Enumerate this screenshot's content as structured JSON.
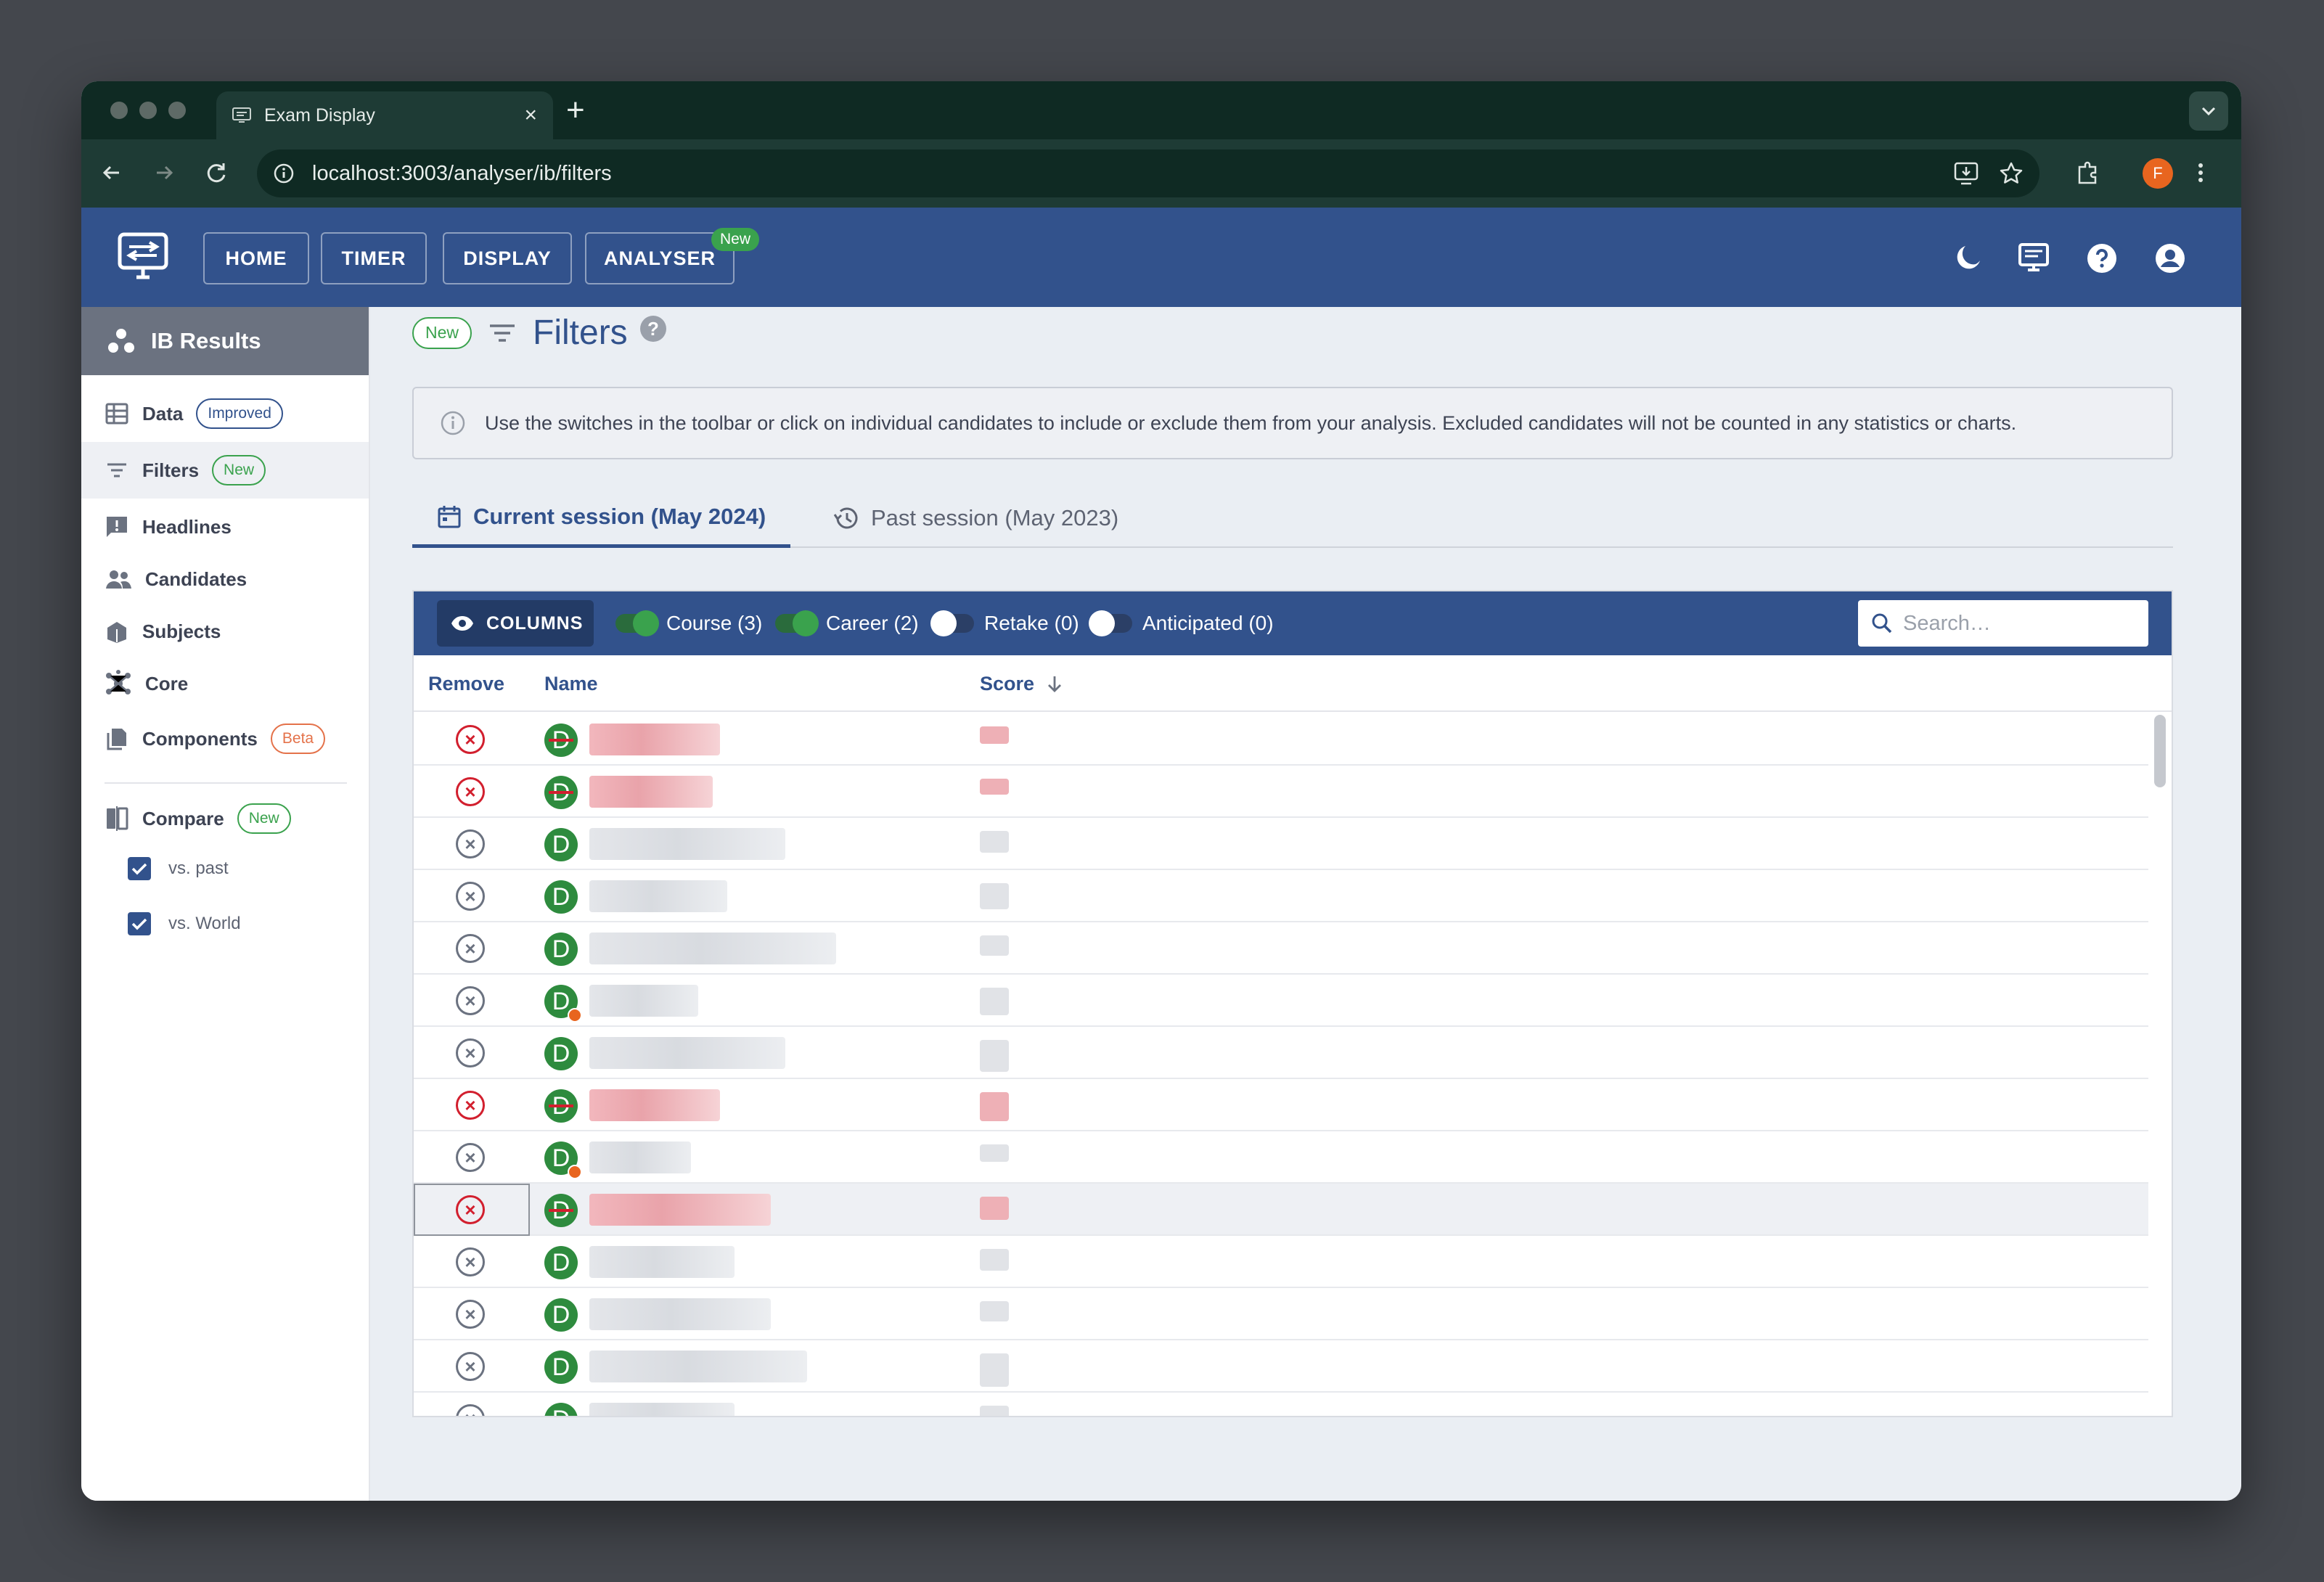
{
  "browser": {
    "tab_title": "Exam Display",
    "url": "localhost:3003/analyser/ib/filters",
    "profile_initial": "F"
  },
  "nav": {
    "home": "HOME",
    "timer": "TIMER",
    "display": "DISPLAY",
    "analyser": "ANALYSER",
    "analyser_badge": "New"
  },
  "sidebar": {
    "header": "IB Results",
    "items": [
      {
        "label": "Data",
        "badge": "Improved"
      },
      {
        "label": "Filters",
        "badge": "New"
      },
      {
        "label": "Headlines"
      },
      {
        "label": "Candidates"
      },
      {
        "label": "Subjects"
      },
      {
        "label": "Core"
      },
      {
        "label": "Components",
        "badge": "Beta"
      }
    ],
    "compare": {
      "label": "Compare",
      "badge": "New"
    },
    "checks": [
      {
        "label": "vs. past",
        "checked": true
      },
      {
        "label": "vs. World",
        "checked": true
      }
    ]
  },
  "page": {
    "badge": "New",
    "title": "Filters",
    "info": "Use the switches in the toolbar or click on individual candidates to include or exclude them from your analysis. Excluded candidates will not be counted in any statistics or charts."
  },
  "session_tabs": {
    "current": "Current session (May 2024)",
    "past": "Past session (May 2023)"
  },
  "table": {
    "columns_button": "COLUMNS",
    "switches": [
      {
        "label": "Course (3)",
        "on": true
      },
      {
        "label": "Career (2)",
        "on": true
      },
      {
        "label": "Retake (0)",
        "on": false
      },
      {
        "label": "Anticipated (0)",
        "on": false
      }
    ],
    "search_placeholder": "Search…",
    "headers": {
      "remove": "Remove",
      "name": "Name",
      "score": "Score"
    },
    "rows": [
      {
        "letter": "D",
        "excluded": true,
        "flag": false
      },
      {
        "letter": "D",
        "excluded": true,
        "flag": false
      },
      {
        "letter": "D",
        "excluded": false,
        "flag": false
      },
      {
        "letter": "D",
        "excluded": false,
        "flag": false
      },
      {
        "letter": "D",
        "excluded": false,
        "flag": false
      },
      {
        "letter": "D",
        "excluded": false,
        "flag": true
      },
      {
        "letter": "D",
        "excluded": false,
        "flag": false
      },
      {
        "letter": "D",
        "excluded": true,
        "flag": false
      },
      {
        "letter": "D",
        "excluded": false,
        "flag": true
      },
      {
        "letter": "D",
        "excluded": true,
        "flag": false,
        "selected": true
      },
      {
        "letter": "D",
        "excluded": false,
        "flag": false
      },
      {
        "letter": "D",
        "excluded": false,
        "flag": false
      },
      {
        "letter": "D",
        "excluded": false,
        "flag": false
      },
      {
        "letter": "D",
        "excluded": false,
        "flag": false
      }
    ]
  },
  "colors": {
    "primary": "#32528c",
    "success": "#3aa24d",
    "danger": "#d21f2e",
    "beta": "#e4724a",
    "browser_frame": "#0f2a23"
  },
  "icons": {
    "remove": "cancel-circle-icon",
    "theme": "moon-icon",
    "display": "monitor-icon",
    "help": "help-icon",
    "account": "account-icon"
  }
}
